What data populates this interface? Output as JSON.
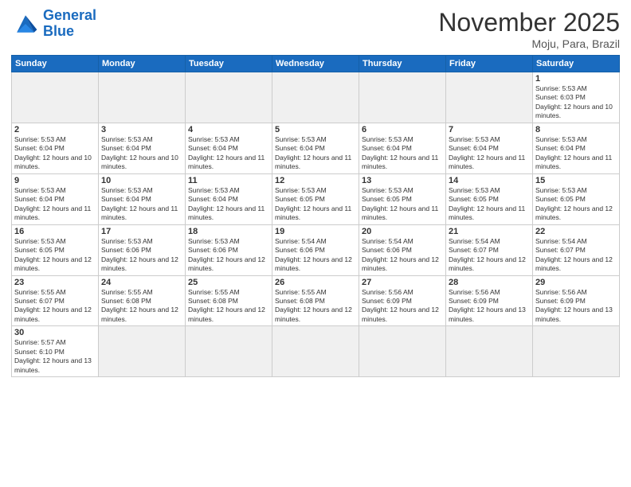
{
  "logo": {
    "text_general": "General",
    "text_blue": "Blue"
  },
  "title": "November 2025",
  "location": "Moju, Para, Brazil",
  "days_of_week": [
    "Sunday",
    "Monday",
    "Tuesday",
    "Wednesday",
    "Thursday",
    "Friday",
    "Saturday"
  ],
  "weeks": [
    [
      {
        "day": "",
        "empty": true
      },
      {
        "day": "",
        "empty": true
      },
      {
        "day": "",
        "empty": true
      },
      {
        "day": "",
        "empty": true
      },
      {
        "day": "",
        "empty": true
      },
      {
        "day": "",
        "empty": true
      },
      {
        "day": "1",
        "sunrise": "5:53 AM",
        "sunset": "6:03 PM",
        "daylight": "12 hours and 10 minutes."
      }
    ],
    [
      {
        "day": "2",
        "sunrise": "5:53 AM",
        "sunset": "6:04 PM",
        "daylight": "12 hours and 10 minutes."
      },
      {
        "day": "3",
        "sunrise": "5:53 AM",
        "sunset": "6:04 PM",
        "daylight": "12 hours and 10 minutes."
      },
      {
        "day": "4",
        "sunrise": "5:53 AM",
        "sunset": "6:04 PM",
        "daylight": "12 hours and 11 minutes."
      },
      {
        "day": "5",
        "sunrise": "5:53 AM",
        "sunset": "6:04 PM",
        "daylight": "12 hours and 11 minutes."
      },
      {
        "day": "6",
        "sunrise": "5:53 AM",
        "sunset": "6:04 PM",
        "daylight": "12 hours and 11 minutes."
      },
      {
        "day": "7",
        "sunrise": "5:53 AM",
        "sunset": "6:04 PM",
        "daylight": "12 hours and 11 minutes."
      },
      {
        "day": "8",
        "sunrise": "5:53 AM",
        "sunset": "6:04 PM",
        "daylight": "12 hours and 11 minutes."
      }
    ],
    [
      {
        "day": "9",
        "sunrise": "5:53 AM",
        "sunset": "6:04 PM",
        "daylight": "12 hours and 11 minutes."
      },
      {
        "day": "10",
        "sunrise": "5:53 AM",
        "sunset": "6:04 PM",
        "daylight": "12 hours and 11 minutes."
      },
      {
        "day": "11",
        "sunrise": "5:53 AM",
        "sunset": "6:04 PM",
        "daylight": "12 hours and 11 minutes."
      },
      {
        "day": "12",
        "sunrise": "5:53 AM",
        "sunset": "6:05 PM",
        "daylight": "12 hours and 11 minutes."
      },
      {
        "day": "13",
        "sunrise": "5:53 AM",
        "sunset": "6:05 PM",
        "daylight": "12 hours and 11 minutes."
      },
      {
        "day": "14",
        "sunrise": "5:53 AM",
        "sunset": "6:05 PM",
        "daylight": "12 hours and 11 minutes."
      },
      {
        "day": "15",
        "sunrise": "5:53 AM",
        "sunset": "6:05 PM",
        "daylight": "12 hours and 12 minutes."
      }
    ],
    [
      {
        "day": "16",
        "sunrise": "5:53 AM",
        "sunset": "6:05 PM",
        "daylight": "12 hours and 12 minutes."
      },
      {
        "day": "17",
        "sunrise": "5:53 AM",
        "sunset": "6:06 PM",
        "daylight": "12 hours and 12 minutes."
      },
      {
        "day": "18",
        "sunrise": "5:53 AM",
        "sunset": "6:06 PM",
        "daylight": "12 hours and 12 minutes."
      },
      {
        "day": "19",
        "sunrise": "5:54 AM",
        "sunset": "6:06 PM",
        "daylight": "12 hours and 12 minutes."
      },
      {
        "day": "20",
        "sunrise": "5:54 AM",
        "sunset": "6:06 PM",
        "daylight": "12 hours and 12 minutes."
      },
      {
        "day": "21",
        "sunrise": "5:54 AM",
        "sunset": "6:07 PM",
        "daylight": "12 hours and 12 minutes."
      },
      {
        "day": "22",
        "sunrise": "5:54 AM",
        "sunset": "6:07 PM",
        "daylight": "12 hours and 12 minutes."
      }
    ],
    [
      {
        "day": "23",
        "sunrise": "5:55 AM",
        "sunset": "6:07 PM",
        "daylight": "12 hours and 12 minutes."
      },
      {
        "day": "24",
        "sunrise": "5:55 AM",
        "sunset": "6:08 PM",
        "daylight": "12 hours and 12 minutes."
      },
      {
        "day": "25",
        "sunrise": "5:55 AM",
        "sunset": "6:08 PM",
        "daylight": "12 hours and 12 minutes."
      },
      {
        "day": "26",
        "sunrise": "5:55 AM",
        "sunset": "6:08 PM",
        "daylight": "12 hours and 12 minutes."
      },
      {
        "day": "27",
        "sunrise": "5:56 AM",
        "sunset": "6:09 PM",
        "daylight": "12 hours and 12 minutes."
      },
      {
        "day": "28",
        "sunrise": "5:56 AM",
        "sunset": "6:09 PM",
        "daylight": "12 hours and 13 minutes."
      },
      {
        "day": "29",
        "sunrise": "5:56 AM",
        "sunset": "6:09 PM",
        "daylight": "12 hours and 13 minutes."
      }
    ],
    [
      {
        "day": "30",
        "sunrise": "5:57 AM",
        "sunset": "6:10 PM",
        "daylight": "12 hours and 13 minutes."
      },
      {
        "day": "",
        "empty": true
      },
      {
        "day": "",
        "empty": true
      },
      {
        "day": "",
        "empty": true
      },
      {
        "day": "",
        "empty": true
      },
      {
        "day": "",
        "empty": true
      },
      {
        "day": "",
        "empty": true
      }
    ]
  ]
}
